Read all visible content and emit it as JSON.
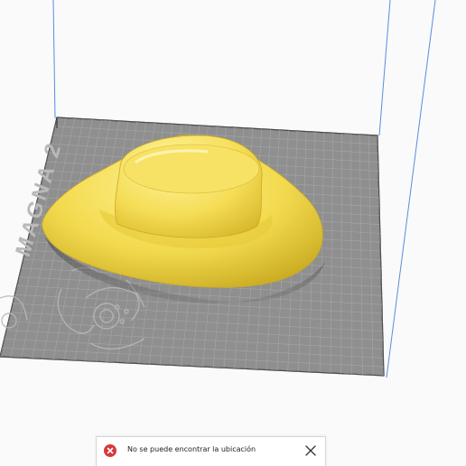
{
  "viewer": {
    "bed_brand": "MAGNA 2",
    "model_name": "hat-icon"
  },
  "notification": {
    "icon": "error-icon",
    "message": "No se puede encontrar la ubicación",
    "close_icon": "close-icon"
  },
  "colors": {
    "background": "#fafafa",
    "bed": "#8f8f8f",
    "grid": "#a4a4a4",
    "model": "#f2da4e",
    "error": "#d43a3a"
  }
}
